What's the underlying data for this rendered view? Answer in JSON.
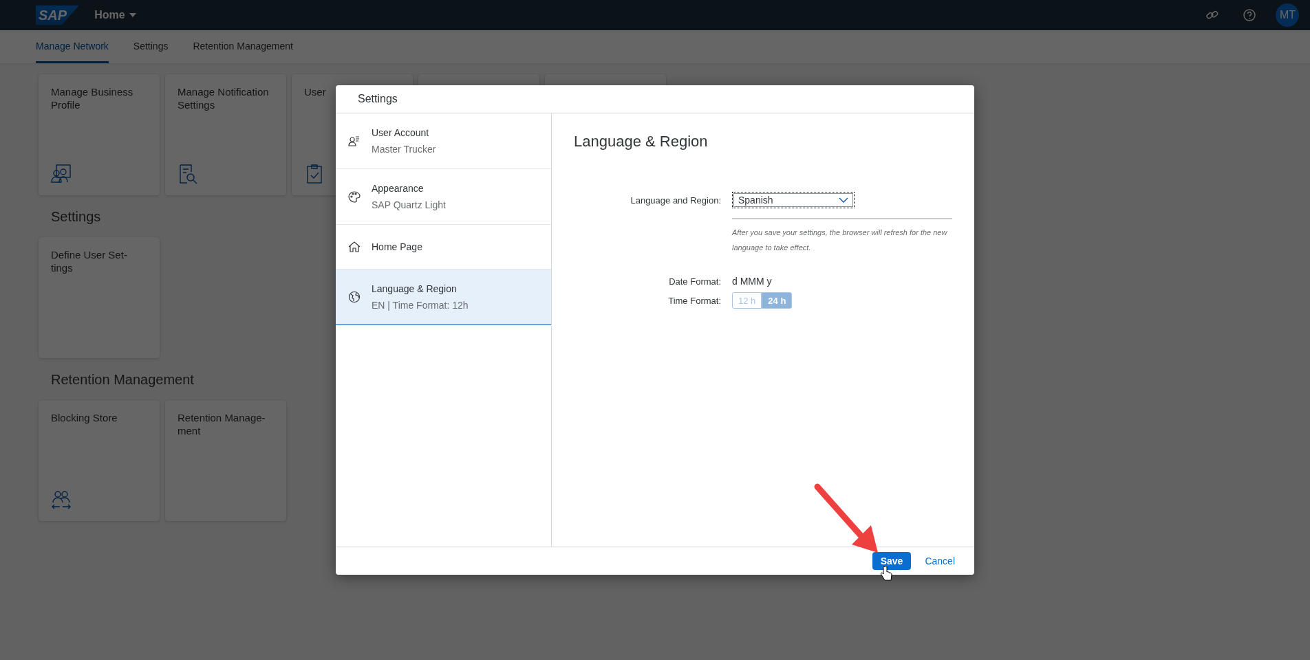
{
  "shell": {
    "logo": "SAP",
    "title": "Home",
    "avatar": "MT"
  },
  "tabs": [
    {
      "label": "Manage Network",
      "selected": true
    },
    {
      "label": "Settings",
      "selected": false
    },
    {
      "label": "Retention Management",
      "selected": false
    }
  ],
  "sections": [
    {
      "tiles": [
        {
          "title": "Manage Business\nProfile"
        },
        {
          "title": "Manage Notification\nSettings"
        },
        {
          "title": "User"
        }
      ]
    },
    {
      "title": "Settings",
      "tiles": [
        {
          "title": "Define User Set-\ntings"
        }
      ]
    },
    {
      "title": "Retention Management",
      "tiles": [
        {
          "title": "Blocking Store"
        },
        {
          "title": "Retention Manage-\nment"
        }
      ]
    }
  ],
  "dialog": {
    "title": "Settings",
    "items": [
      {
        "title": "User Account",
        "subtitle": "Master Trucker",
        "selected": false
      },
      {
        "title": "Appearance",
        "subtitle": "SAP Quartz Light",
        "selected": false
      },
      {
        "title": "Home Page",
        "selected": false
      },
      {
        "title": "Language & Region",
        "subtitle": "EN | Time Format: 12h",
        "selected": true
      }
    ],
    "detail": {
      "heading": "Language & Region",
      "language_label": "Language and Region:",
      "language_value": "Spanish",
      "hint": "After you save your settings, the browser will refresh for the new language to take effect.",
      "date_label": "Date Format:",
      "date_value": "d MMM y",
      "time_label": "Time Format:",
      "time_options": [
        {
          "label": "12 h",
          "selected": false
        },
        {
          "label": "24 h",
          "selected": true
        }
      ]
    },
    "buttons": [
      {
        "label": "Save",
        "kind": "primary"
      },
      {
        "label": "Cancel",
        "kind": "link"
      }
    ]
  }
}
